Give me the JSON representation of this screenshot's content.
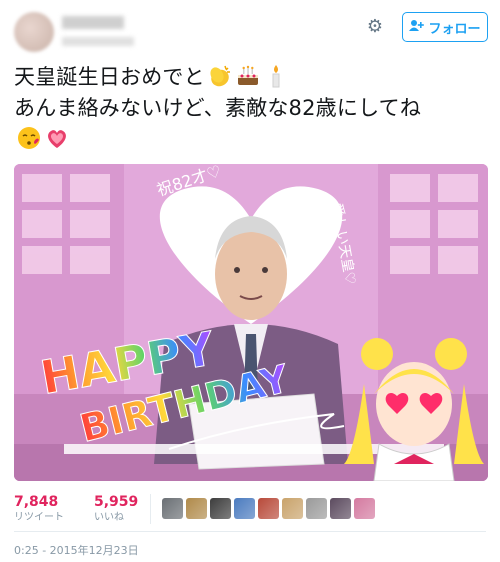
{
  "header": {
    "display_name": "██████",
    "handle": "@██████",
    "settings_icon": "gear-icon",
    "follow_label": "フォロー",
    "follow_icon": "follow-user-icon"
  },
  "tweet": {
    "line1": "天皇誕生日おめでと",
    "line2": "あんま絡みないけど、素敵な82歳にしてね",
    "emojis_line1": [
      "clapping-hands-emoji",
      "birthday-cake-emoji",
      "candle-emoji"
    ],
    "emojis_line3": [
      "kissing-face-emoji",
      "pink-heart-emoji"
    ]
  },
  "media": {
    "handwritten_top": "祝82才♡",
    "handwritten_right": "愛しい天皇♡",
    "happy_text": "HAPPY",
    "birthday_text": "BIRTHDAY"
  },
  "stats": {
    "retweets_count": "7,848",
    "retweets_label": "リツイート",
    "likes_count": "5,959",
    "likes_label": "いいね"
  },
  "likers": [
    {
      "color": "#6a6f74"
    },
    {
      "color": "#b08a4a"
    },
    {
      "color": "#3d3d3d"
    },
    {
      "color": "#4b7bbf"
    },
    {
      "color": "#b84a3a"
    },
    {
      "color": "#c9a36b"
    },
    {
      "color": "#9a9a9a"
    },
    {
      "color": "#5c4b5f"
    },
    {
      "color": "#d47aa0"
    }
  ],
  "timestamp": "0:25 - 2015年12月23日",
  "colors": {
    "accent": "#1da1f2",
    "stat": "#e0245e",
    "muted": "#8899a6"
  }
}
